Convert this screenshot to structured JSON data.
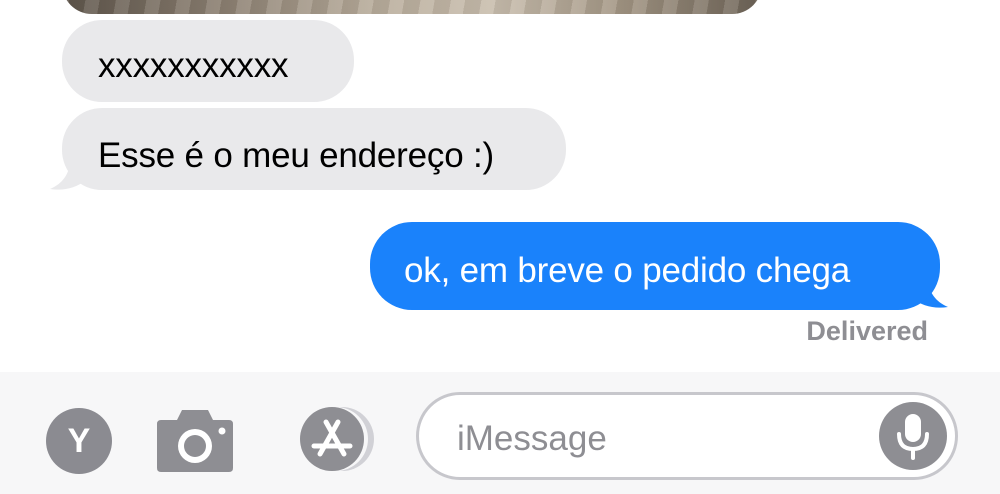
{
  "conversation": {
    "messages": [
      {
        "direction": "incoming",
        "text": "xxxxxxxxxxx"
      },
      {
        "direction": "incoming",
        "text": "Esse é o meu endereço :)"
      },
      {
        "direction": "outgoing",
        "text": "ok, em breve o pedido chega"
      }
    ],
    "delivery_status": "Delivered"
  },
  "composer": {
    "avatar_initial": "Y",
    "placeholder": "iMessage",
    "icons": [
      "camera-icon",
      "app-store-icon",
      "microphone-icon"
    ]
  },
  "colors": {
    "outgoing_bubble": "#1a82fb",
    "incoming_bubble": "#e9e9eb",
    "icon_gray": "#8e8e93"
  }
}
